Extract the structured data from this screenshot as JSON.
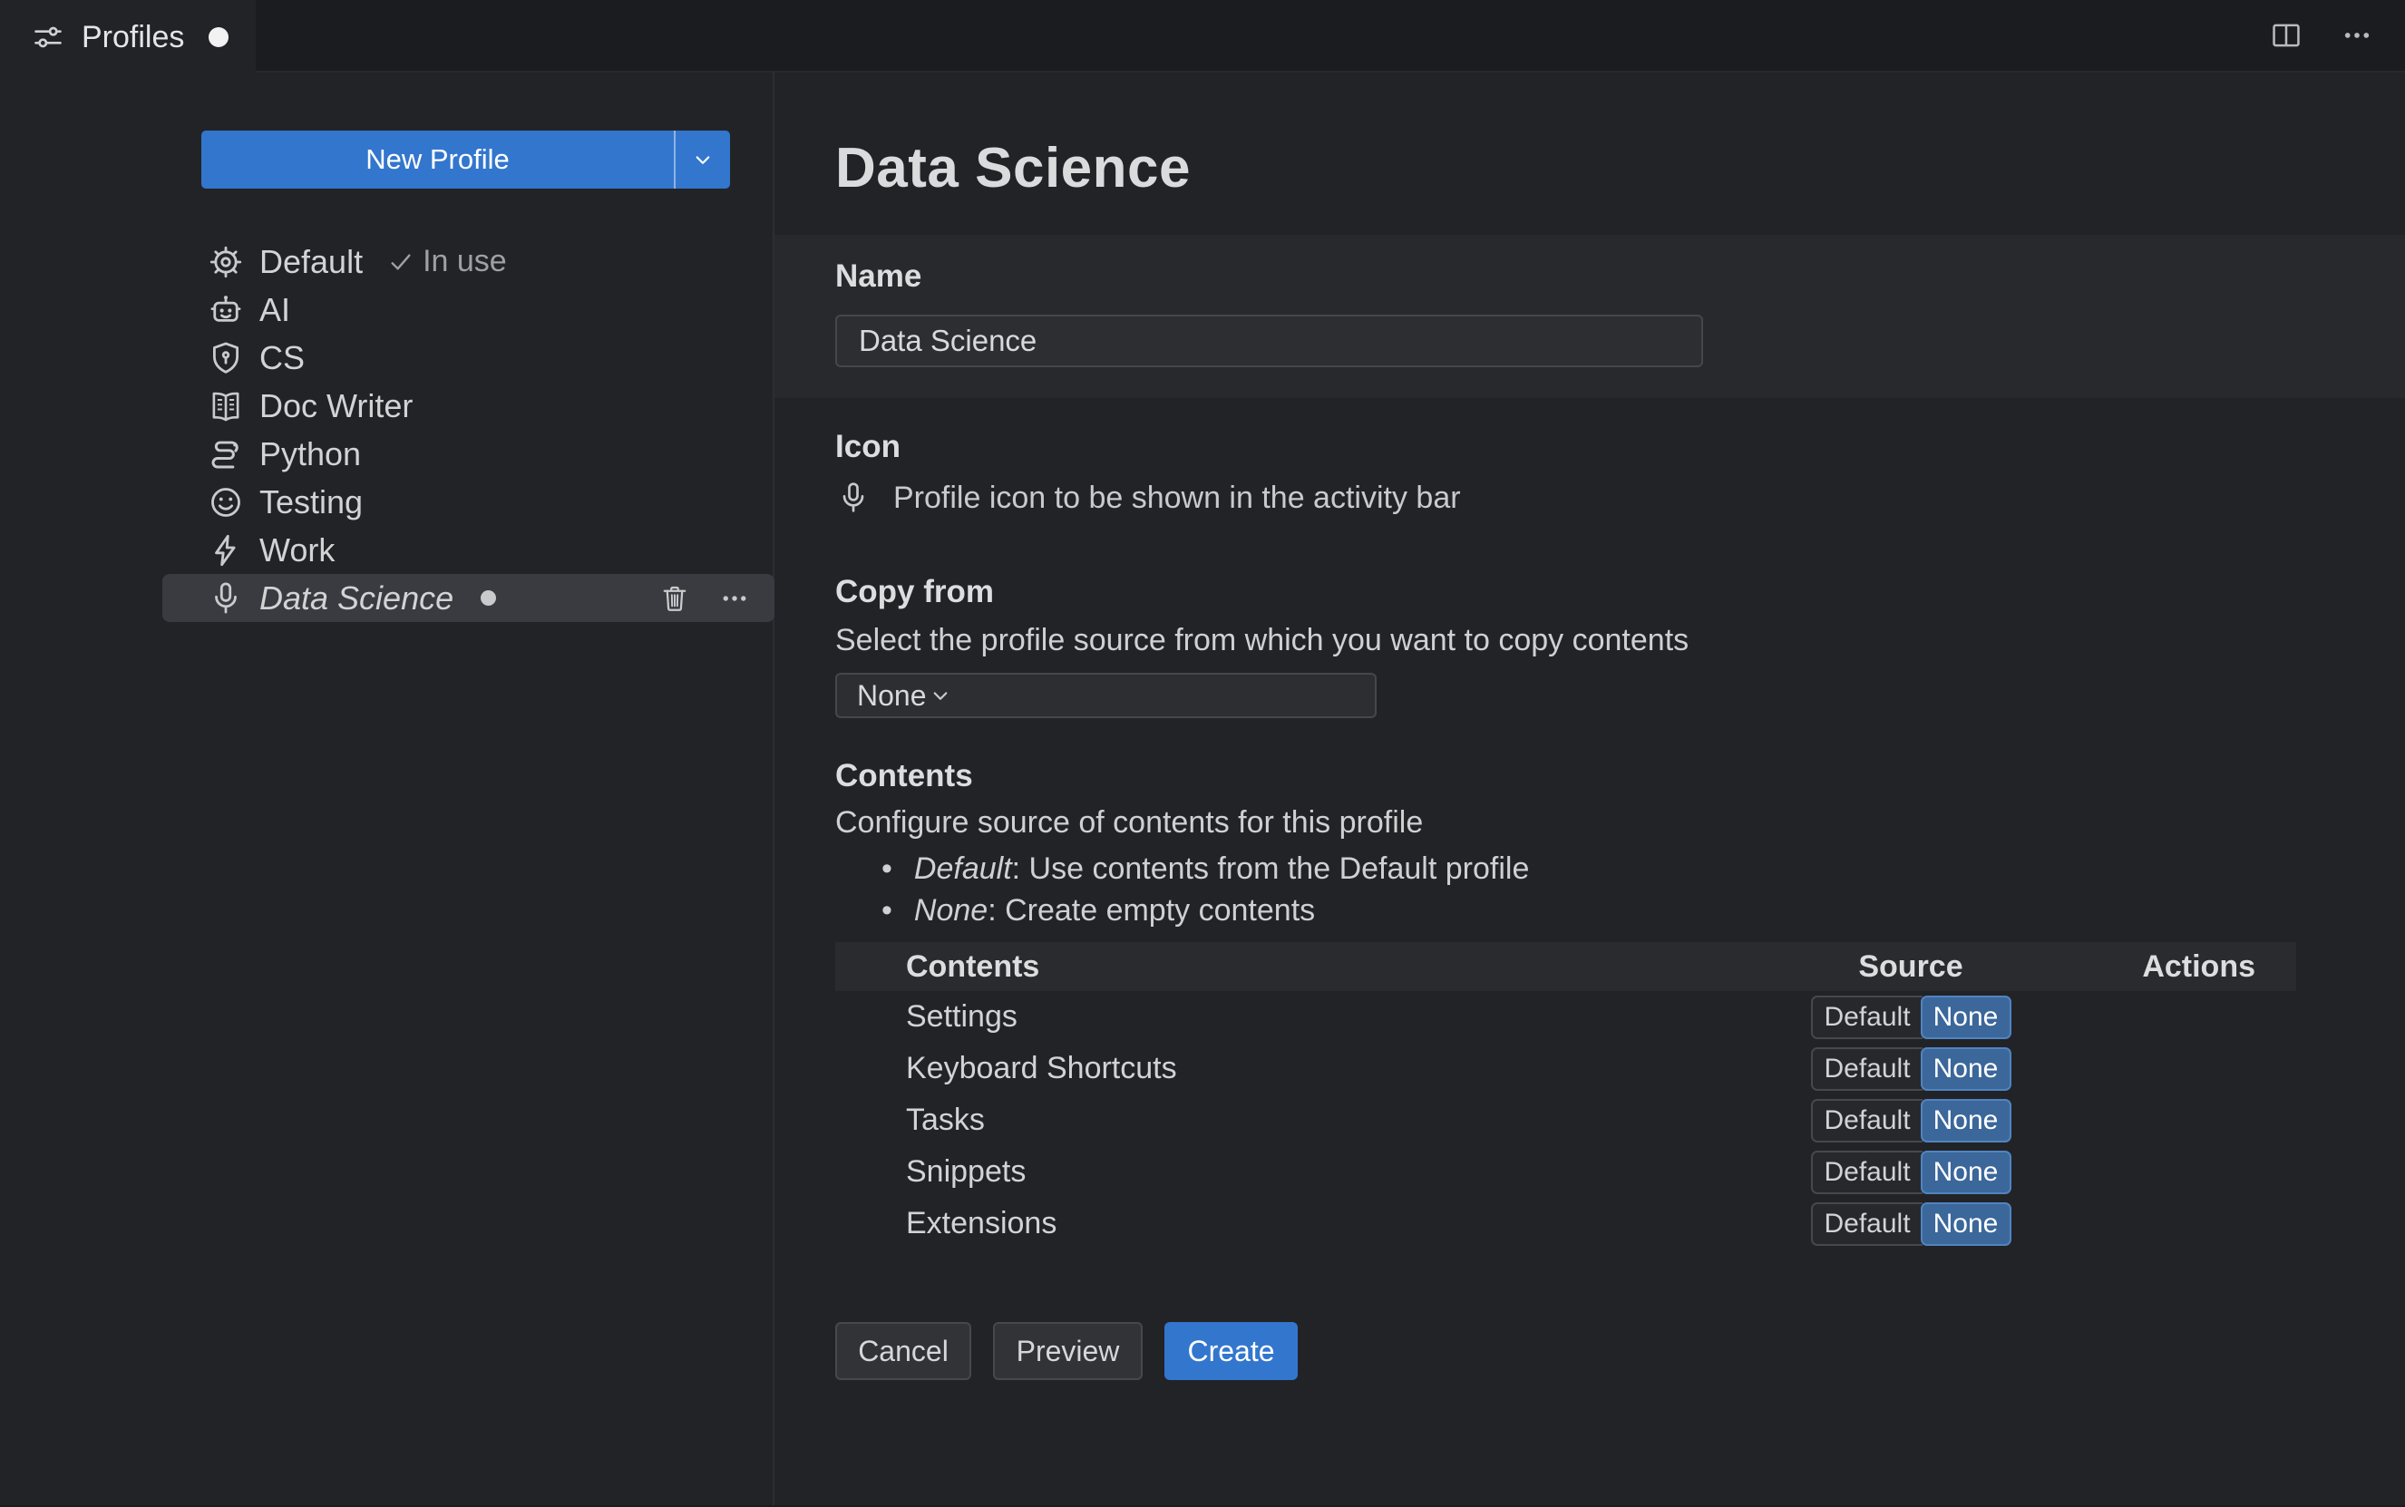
{
  "window": {
    "tab": {
      "label": "Profiles",
      "modified": true
    },
    "actions": {
      "split_editor": "split-editor",
      "more": "more-actions"
    }
  },
  "sidebar": {
    "new_profile_label": "New Profile",
    "profiles": [
      {
        "name": "Default",
        "icon": "gear",
        "badge": "In use",
        "in_use": true
      },
      {
        "name": "AI",
        "icon": "robot"
      },
      {
        "name": "CS",
        "icon": "shield"
      },
      {
        "name": "Doc Writer",
        "icon": "book"
      },
      {
        "name": "Python",
        "icon": "snake"
      },
      {
        "name": "Testing",
        "icon": "smiley"
      },
      {
        "name": "Work",
        "icon": "zap"
      },
      {
        "name": "Data Science",
        "icon": "mic",
        "selected": true,
        "modified": true
      }
    ]
  },
  "editor": {
    "title": "Data Science",
    "name_section": {
      "label": "Name",
      "value": "Data Science"
    },
    "icon_section": {
      "label": "Icon",
      "icon": "mic",
      "description": "Profile icon to be shown in the activity bar"
    },
    "copy_from": {
      "label": "Copy from",
      "description": "Select the profile source from which you want to copy contents",
      "value": "None"
    },
    "contents_section": {
      "label": "Contents",
      "description": "Configure source of contents for this profile",
      "bullets": [
        {
          "term": "Default",
          "text": ": Use contents from the Default profile"
        },
        {
          "term": "None",
          "text": ": Create empty contents"
        }
      ],
      "table": {
        "headers": [
          "Contents",
          "Source",
          "Actions"
        ],
        "source_options": [
          "Default",
          "None"
        ],
        "rows": [
          {
            "label": "Settings",
            "source": "None"
          },
          {
            "label": "Keyboard Shortcuts",
            "source": "None"
          },
          {
            "label": "Tasks",
            "source": "None"
          },
          {
            "label": "Snippets",
            "source": "None"
          },
          {
            "label": "Extensions",
            "source": "None"
          }
        ]
      }
    },
    "footer": {
      "cancel": "Cancel",
      "preview": "Preview",
      "create": "Create"
    }
  },
  "colors": {
    "accent_blue": "#3376cd",
    "toggle_selected_blue": "#3b679a",
    "background": "#222327",
    "tab_strip": "#1b1c1f",
    "selected_row": "#3a3b40"
  }
}
